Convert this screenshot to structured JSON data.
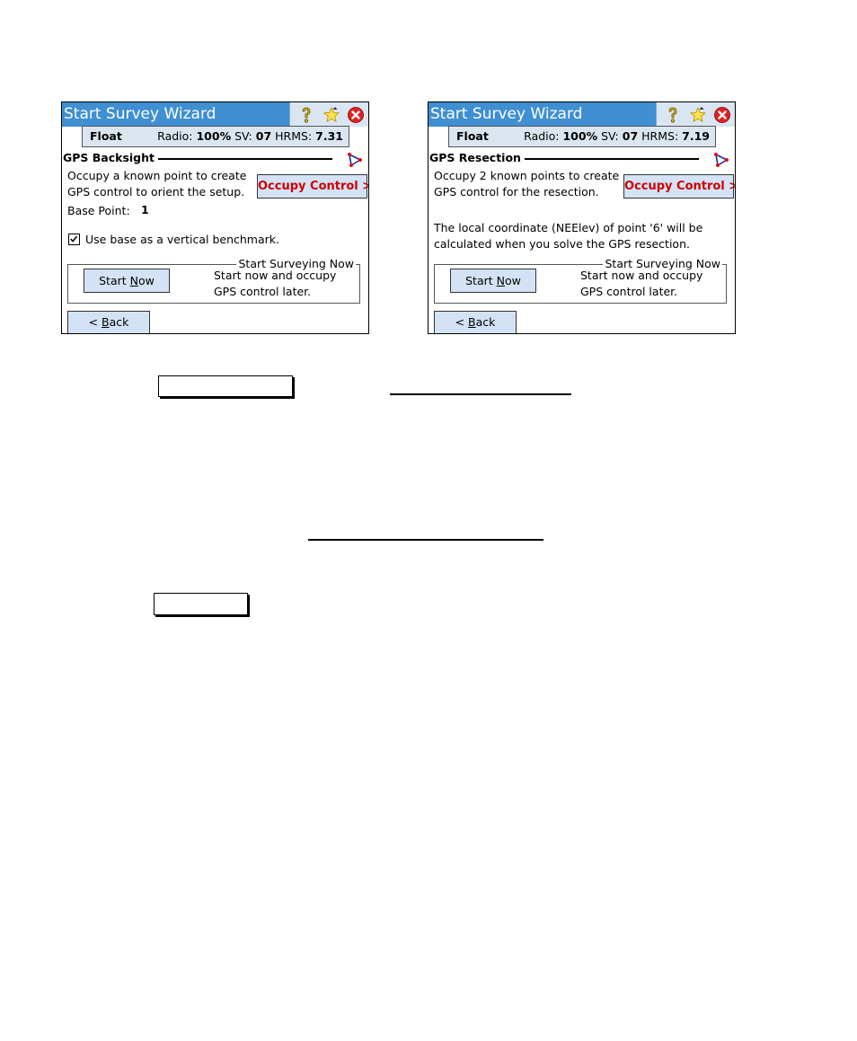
{
  "screenshots": [
    {
      "title": "Start Survey Wizard",
      "status": {
        "fix": "Float",
        "radio_label": "Radio:",
        "radio_value": "100%",
        "sv_label": "SV:",
        "sv_value": "07",
        "hrms_label": "HRMS:",
        "hrms_value": "7.31"
      },
      "section_title": "GPS Backsight",
      "description_lines": [
        "Occupy a known point to create",
        "GPS control to orient the setup."
      ],
      "occupy_button": "Occupy Control >",
      "base_point_label": "Base Point:",
      "base_point_value": "1",
      "checkbox_label": "Use base as a vertical benchmark.",
      "checkbox_checked": true,
      "group_title": "Start Surveying Now",
      "start_button": {
        "pre": "Start ",
        "mnemonic": "N",
        "post": "ow"
      },
      "start_desc_lines": [
        "Start now and occupy",
        "GPS control later."
      ],
      "back_button": {
        "pre": "< ",
        "mnemonic": "B",
        "post": "ack"
      }
    },
    {
      "title": "Start Survey Wizard",
      "status": {
        "fix": "Float",
        "radio_label": "Radio:",
        "radio_value": "100%",
        "sv_label": "SV:",
        "sv_value": "07",
        "hrms_label": "HRMS:",
        "hrms_value": "7.19"
      },
      "section_title": "GPS Resection",
      "description_lines": [
        "Occupy 2 known points to create",
        "GPS control for the resection."
      ],
      "occupy_button": "Occupy Control >",
      "note_lines": [
        "The local coordinate (NEElev) of point '6' will be",
        "calculated when you solve the GPS resection."
      ],
      "group_title": "Start Surveying Now",
      "start_button": {
        "pre": "Start ",
        "mnemonic": "N",
        "post": "ow"
      },
      "start_desc_lines": [
        "Start now and occupy",
        "GPS control later."
      ],
      "back_button": {
        "pre": "< ",
        "mnemonic": "B",
        "post": "ack"
      }
    }
  ],
  "colors": {
    "titlebar": "#3f8fd2",
    "button_bg": "#d3e3f5",
    "occupy_text": "#cc0000"
  }
}
